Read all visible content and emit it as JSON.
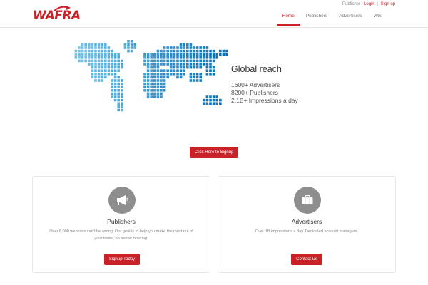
{
  "brand": {
    "logo_text": "WAFRA",
    "accent_color": "#c82128"
  },
  "account": {
    "role": "Publisher :",
    "login": "Login",
    "separator": "|",
    "signup": "Sign up"
  },
  "nav": {
    "items": [
      {
        "label": "Home",
        "active": true
      },
      {
        "label": "Publishers",
        "active": false
      },
      {
        "label": "Advertisers",
        "active": false
      },
      {
        "label": "Wiki",
        "active": false
      }
    ]
  },
  "hero": {
    "title": "Global reach",
    "stats": [
      "1600+ Advertisers",
      "8200+ Publishers",
      "2.1B+ Impressions a day"
    ],
    "signup_button": "Click Here to Signup",
    "map_icon": "world-map-dot-matrix"
  },
  "cards": {
    "publishers": {
      "icon": "megaphone-icon",
      "title": "Publishers",
      "description": "Over 8,000 websites can't be wrong. Our goal is to help you make the most out of your traffic, no matter how big.",
      "button": "Signup Today"
    },
    "advertisers": {
      "icon": "briefcase-icon",
      "title": "Advertisers",
      "description": "Over 1B impressions a day. Dedicated account managers.",
      "button": "Contact Us"
    }
  }
}
